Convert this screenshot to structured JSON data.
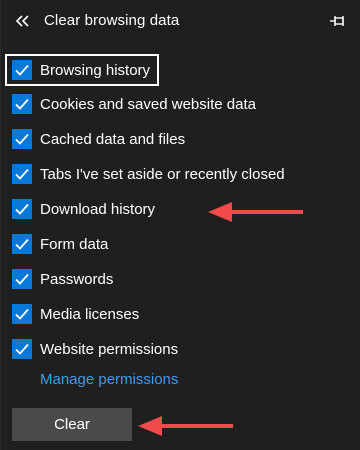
{
  "header": {
    "title": "Clear browsing data",
    "back_icon": "double-chevron-left-icon",
    "pin_icon": "pin-icon"
  },
  "items": [
    {
      "label": "Browsing history",
      "checked": true,
      "focused": true
    },
    {
      "label": "Cookies and saved website data",
      "checked": true
    },
    {
      "label": "Cached data and files",
      "checked": true
    },
    {
      "label": "Tabs I've set aside or recently closed",
      "checked": true
    },
    {
      "label": "Download history",
      "checked": true
    },
    {
      "label": "Form data",
      "checked": true
    },
    {
      "label": "Passwords",
      "checked": true
    },
    {
      "label": "Media licenses",
      "checked": true
    },
    {
      "label": "Website permissions",
      "checked": true
    }
  ],
  "manage_link": "Manage permissions",
  "clear_button": "Clear",
  "colors": {
    "background": "#1f1f1f",
    "checkbox": "#0a78d7",
    "link": "#3d9cf0",
    "button": "#4a4a4a",
    "annotation_arrow": "#f04a4a"
  }
}
